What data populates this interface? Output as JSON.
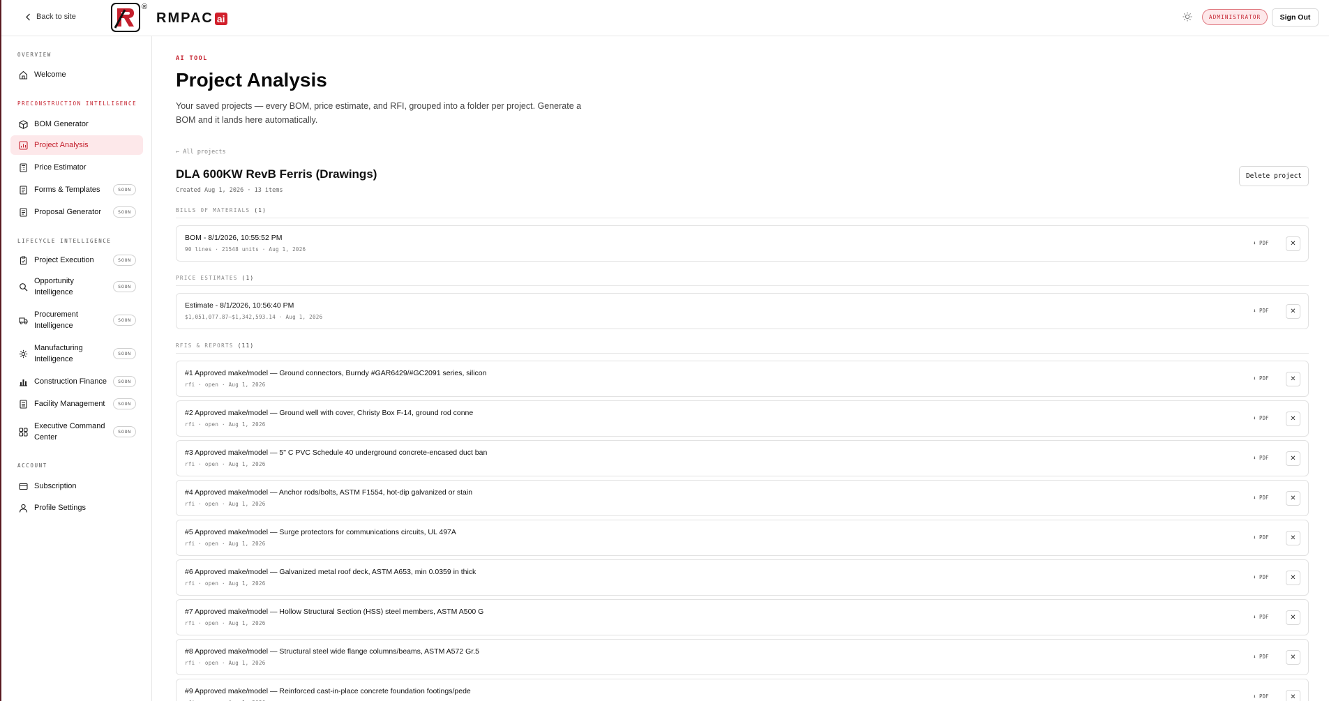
{
  "header": {
    "back_label": "Back to site",
    "logo_text": "RMPAC",
    "logo_ai": "ai",
    "logo_reg": "®",
    "role_badge": "ADMINISTRATOR",
    "sign_out": "Sign Out"
  },
  "sidebar": {
    "overview_label": "OVERVIEW",
    "welcome": "Welcome",
    "precon_label": "PRECONSTRUCTION INTELLIGENCE",
    "bom_generator": "BOM Generator",
    "project_analysis": "Project Analysis",
    "price_estimator": "Price Estimator",
    "forms_templates": "Forms & Templates",
    "proposal_generator": "Proposal Generator",
    "lifecycle_label": "LIFECYCLE INTELLIGENCE",
    "project_execution": "Project Execution",
    "opportunity_intelligence": "Opportunity Intelligence",
    "procurement_intelligence": "Procurement Intelligence",
    "manufacturing_intelligence": "Manufacturing Intelligence",
    "construction_finance": "Construction Finance",
    "facility_management": "Facility Management",
    "executive_command_center": "Executive Command Center",
    "account_label": "ACCOUNT",
    "subscription": "Subscription",
    "profile_settings": "Profile Settings",
    "soon_badge": "SOON"
  },
  "main": {
    "eyebrow": "AI TOOL",
    "title": "Project Analysis",
    "description": "Your saved projects — every BOM, price estimate, and RFI, grouped into a folder per project. Generate a BOM and it lands here automatically.",
    "all_projects": "← All projects",
    "project_title": "DLA 600KW RevB Ferris (Drawings)",
    "project_meta": "Created Aug 1, 2026 · 13 items",
    "delete_label": "Delete project",
    "pdf_label": "⬇ PDF",
    "close_glyph": "✕",
    "boms_label": "BILLS OF MATERIALS",
    "boms_count": "(1)",
    "bom": {
      "title": "BOM - 8/1/2026, 10:55:52 PM",
      "meta": "90 lines · 21548 units · Aug 1, 2026"
    },
    "estimates_label": "PRICE ESTIMATES",
    "estimates_count": "(1)",
    "estimate": {
      "title": "Estimate - 8/1/2026, 10:56:40 PM",
      "meta": "$1,051,077.87–$1,342,593.14 · Aug 1, 2026"
    },
    "rfis_label": "RFIS & REPORTS",
    "rfis_count": "(11)",
    "rfi_meta": "rfi · open · Aug 1, 2026",
    "rfis": [
      "#1 Approved make/model — Ground connectors, Burndy #GAR6429/#GC2091 series, silicon",
      "#2 Approved make/model — Ground well with cover, Christy Box F-14, ground rod conne",
      "#3 Approved make/model — 5\" C PVC Schedule 40 underground concrete-encased duct ban",
      "#4 Approved make/model — Anchor rods/bolts, ASTM F1554, hot-dip galvanized or stain",
      "#5 Approved make/model — Surge protectors for communications circuits, UL 497A",
      "#6 Approved make/model — Galvanized metal roof deck, ASTM A653, min 0.0359 in thick",
      "#7 Approved make/model — Hollow Structural Section (HSS) steel members, ASTM A500 G",
      "#8 Approved make/model — Structural steel wide flange columns/beams, ASTM A572 Gr.5",
      "#9 Approved make/model — Reinforced cast-in-place concrete foundation footings/pede"
    ]
  },
  "colors": {
    "accent": "#c4202d",
    "accent_bg": "#fde8ea",
    "border": "#e2e2e2"
  },
  "icons": [
    "chevron-left-icon",
    "logo-r-icon",
    "sun-icon",
    "home-icon",
    "cube-icon",
    "chart-icon",
    "calculator-icon",
    "doc-icon",
    "clipboard-icon",
    "search-icon",
    "truck-icon",
    "gear-icon",
    "bar-chart-icon",
    "building-icon",
    "grid-icon",
    "card-icon",
    "user-icon"
  ]
}
